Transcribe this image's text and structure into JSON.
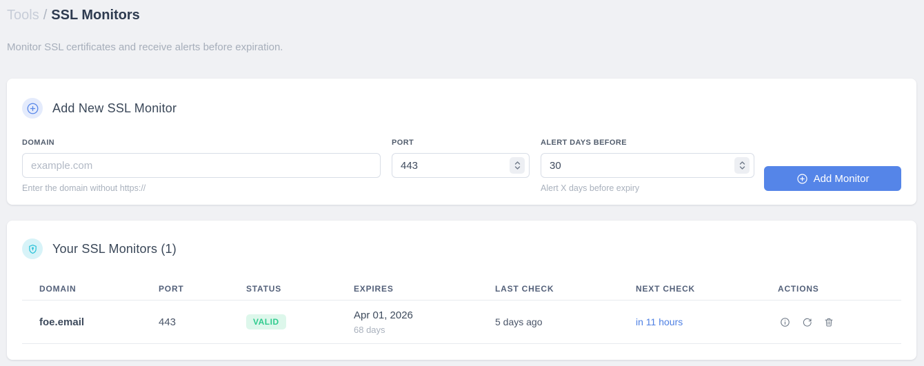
{
  "page": {
    "breadcrumb": {
      "section": "Tools",
      "separator": "/",
      "current": "SSL Monitors"
    },
    "subtitle": "Monitor SSL certificates and receive alerts before expiration."
  },
  "add_monitor_card": {
    "title": "Add New SSL Monitor",
    "fields": {
      "domain": {
        "label": "DOMAIN",
        "placeholder": "example.com",
        "value": "",
        "helper": "Enter the domain without https://"
      },
      "port": {
        "label": "PORT",
        "value": "443"
      },
      "alert_days": {
        "label": "ALERT DAYS BEFORE",
        "value": "30",
        "helper": "Alert X days before expiry"
      }
    },
    "submit_label": "Add Monitor"
  },
  "monitors_card": {
    "title": "Your SSL Monitors (1)",
    "table": {
      "headers": [
        "DOMAIN",
        "PORT",
        "STATUS",
        "EXPIRES",
        "LAST CHECK",
        "NEXT CHECK",
        "ACTIONS"
      ],
      "rows": [
        {
          "domain": "foe.email",
          "port": "443",
          "status": "VALID",
          "expires_date": "Apr 01, 2026",
          "expires_days": "68 days",
          "last_check": "5 days ago",
          "next_check": "in 11 hours"
        }
      ]
    }
  },
  "icons": {
    "add_header": "plus-circle-icon",
    "monitors_header": "shield-lock-icon",
    "row_actions": [
      "info-icon",
      "refresh-icon",
      "trash-icon"
    ]
  },
  "colors": {
    "accent_blue": "#5585e8",
    "accent_cyan": "#2bc2d8",
    "success_text": "#2fcb8e",
    "success_bg": "#ddf7eb",
    "link_blue": "#4d7fe3",
    "page_bg": "#f0f1f4"
  }
}
